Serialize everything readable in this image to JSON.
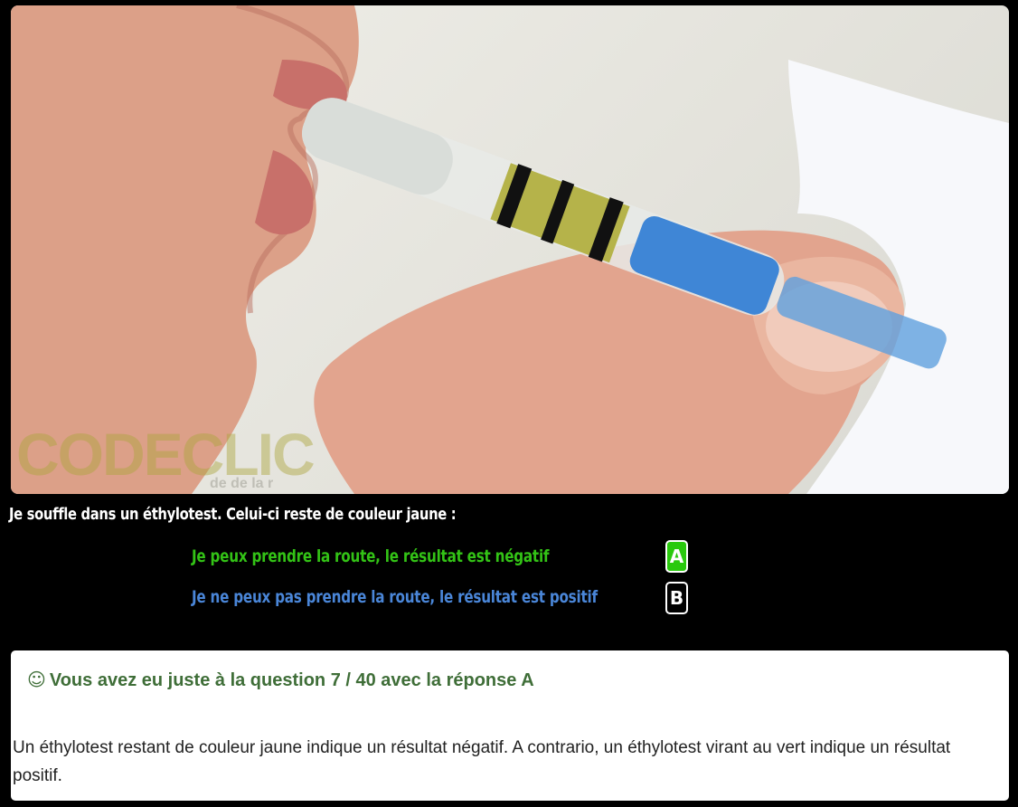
{
  "photo": {
    "watermark": "CODECLIC",
    "watermark_sub": "de de la r"
  },
  "question": {
    "text": "Je souffle dans un éthylotest. Celui-ci reste de couleur jaune :"
  },
  "answers": [
    {
      "key": "A",
      "text": "Je peux prendre la route, le résultat est négatif",
      "color": "#33c316",
      "selected": true
    },
    {
      "key": "B",
      "text": "Je ne peux pas prendre la route, le résultat est positif",
      "color": "#4a86d8",
      "selected": false
    }
  ],
  "result": {
    "icon": "☺",
    "title": "Vous avez eu juste à la question 7 / 40 avec la réponse A",
    "explanation": "Un éthylotest restant de couleur jaune indique un résultat négatif. A contrario, un éthylotest virant au vert indique un résultat positif.",
    "title_color": "#3f6e38"
  },
  "colors": {
    "correct_key_bg": "#29c90d",
    "background": "#000000"
  }
}
